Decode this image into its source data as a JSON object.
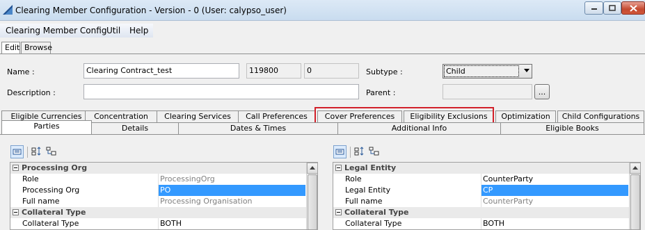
{
  "window": {
    "title": "Clearing Member Configuration - Version - 0 (User: calypso_user)",
    "minimize_icon": "minimize-icon",
    "maximize_icon": "maximize-icon",
    "close_icon": "close-icon"
  },
  "menu": {
    "items": [
      "Clearing Member Config",
      "Util",
      "Help"
    ]
  },
  "mode_tabs": [
    "Edit",
    "Browse"
  ],
  "form": {
    "name_label": "Name :",
    "name_value": "Clearing Contract_test",
    "id_value": "119800",
    "version_value": "0",
    "subtype_label": "Subtype :",
    "subtype_value": "Child",
    "description_label": "Description :",
    "description_value": "",
    "parent_label": "Parent :",
    "parent_value": "",
    "browse_button": "..."
  },
  "tab_row_1": [
    "Eligible Currencies",
    "Concentration",
    "Clearing Services",
    "Call Preferences",
    "Cover Preferences",
    "Eligibility Exclusions",
    "Optimization",
    "Child Configurations"
  ],
  "tab_row_2": [
    "Parties",
    "Details",
    "Dates & Times",
    "Additional Info",
    "Eligible Books"
  ],
  "highlight_color": "#d2202a",
  "left_panel": {
    "groups": [
      {
        "title": "Processing Org",
        "rows": [
          {
            "key": "Role",
            "value": "ProcessingOrg",
            "style": "muted"
          },
          {
            "key": "Processing Org",
            "value": "PO",
            "style": "selected"
          },
          {
            "key": "Full name",
            "value": "Processing Organisation",
            "style": "muted"
          }
        ]
      },
      {
        "title": "Collateral Type",
        "rows": [
          {
            "key": "Collateral Type",
            "value": "BOTH",
            "style": "normal"
          }
        ]
      }
    ]
  },
  "right_panel": {
    "groups": [
      {
        "title": "Legal Entity",
        "rows": [
          {
            "key": "Role",
            "value": "CounterParty",
            "style": "normal"
          },
          {
            "key": "Legal Entity",
            "value": "CP",
            "style": "selected"
          },
          {
            "key": "Full name",
            "value": "CounterParty",
            "style": "muted"
          }
        ]
      },
      {
        "title": "Collateral Type",
        "rows": [
          {
            "key": "Collateral Type",
            "value": "BOTH",
            "style": "normal"
          }
        ]
      }
    ]
  }
}
